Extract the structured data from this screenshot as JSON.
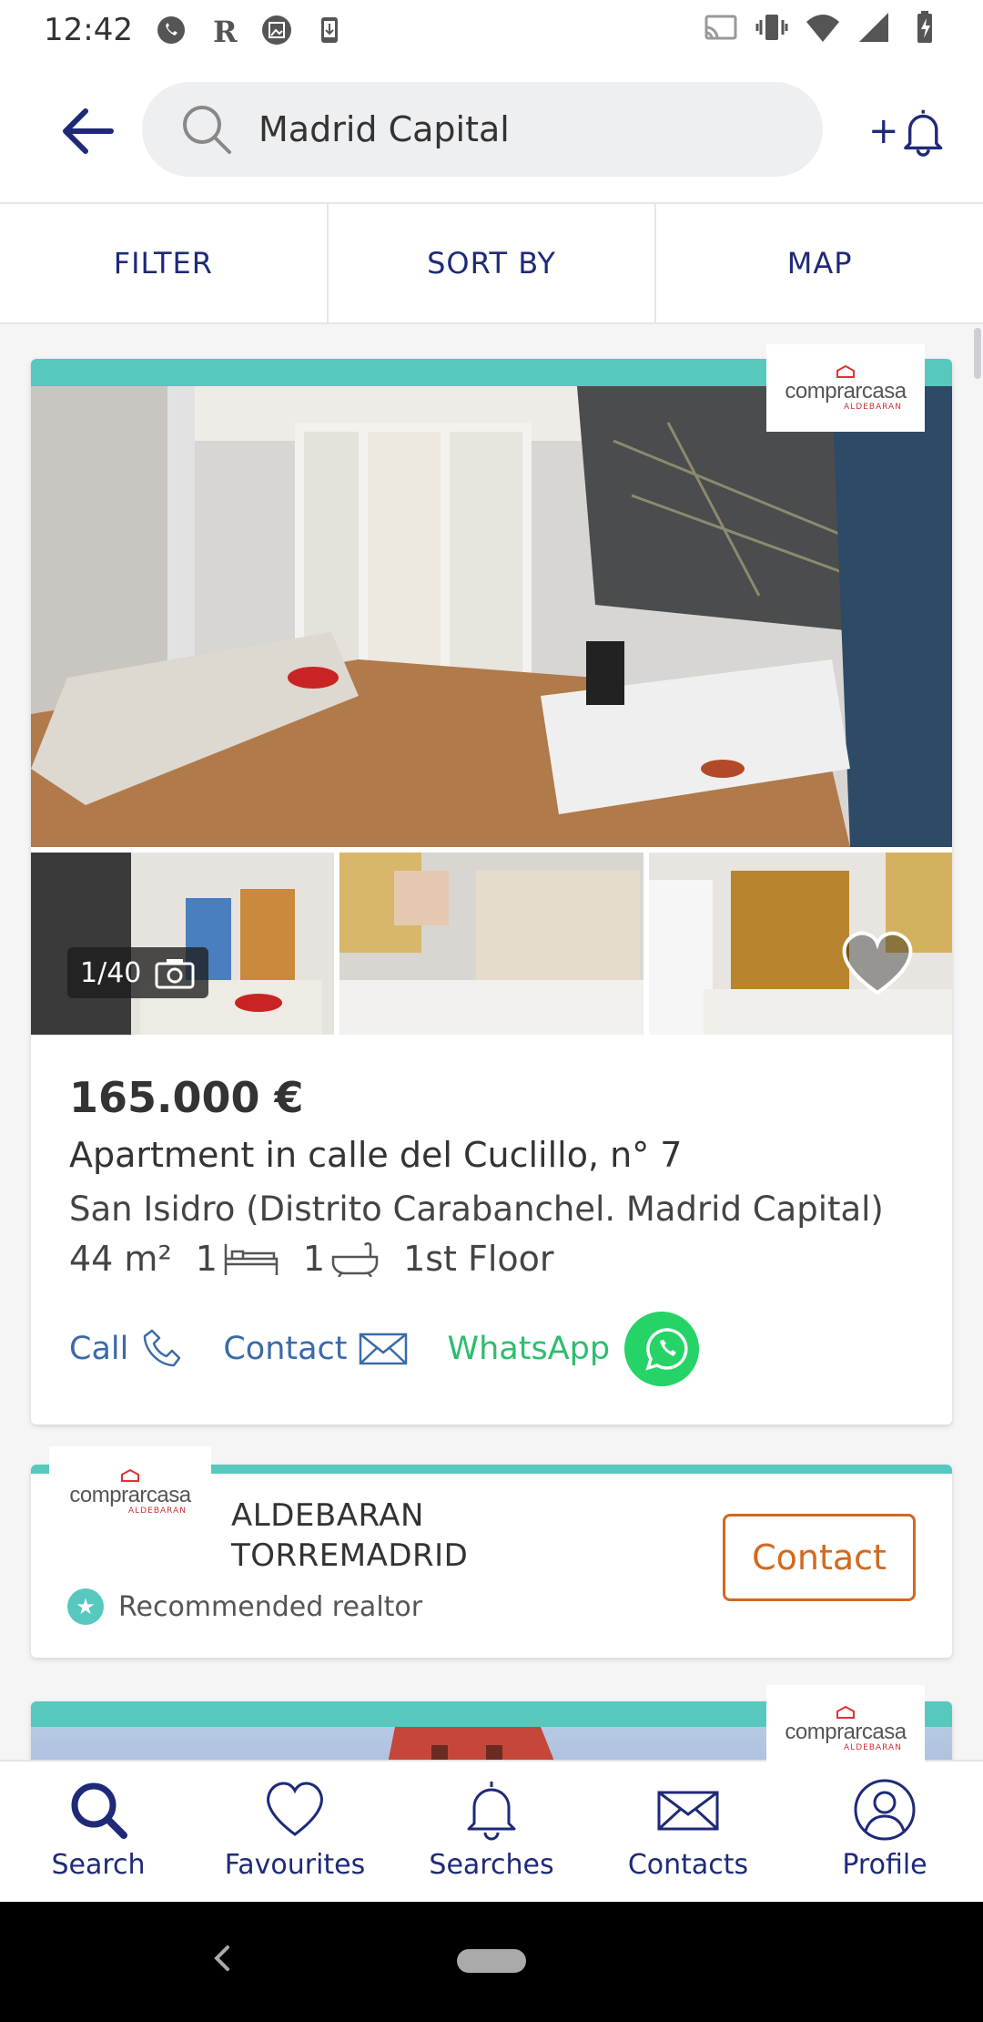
{
  "status_bar": {
    "time": "12:42"
  },
  "header": {
    "search_value": "Madrid Capital",
    "alert_plus": "+"
  },
  "tabs": [
    {
      "label": "FILTER"
    },
    {
      "label": "SORT BY"
    },
    {
      "label": "MAP"
    }
  ],
  "listing": {
    "agency_logo": "comprarcasa",
    "agency_logo_sub": "ALDEBARAN",
    "photo_counter": "1/40",
    "price": "165.000 €",
    "title": "Apartment in calle del Cuclillo, n° 7",
    "location": "San Isidro (Distrito Carabanchel. Madrid Capital)",
    "area": "44 m²",
    "bedrooms": "1",
    "bathrooms": "1",
    "floor": "1st Floor",
    "actions": {
      "call": "Call",
      "contact": "Contact",
      "whatsapp": "WhatsApp"
    }
  },
  "realtor": {
    "logo": "comprarcasa",
    "logo_sub": "ALDEBARAN",
    "name_line1": "ALDEBARAN",
    "name_line2": "TORREMADRID",
    "badge": "Recommended realtor",
    "contact_button": "Contact"
  },
  "next_listing": {
    "logo": "comprarcasa",
    "logo_sub": "ALDEBARAN"
  },
  "bottom_nav": [
    {
      "label": "Search",
      "icon": "search-icon"
    },
    {
      "label": "Favourites",
      "icon": "heart-icon"
    },
    {
      "label": "Searches",
      "icon": "bell-icon"
    },
    {
      "label": "Contacts",
      "icon": "envelope-icon"
    },
    {
      "label": "Profile",
      "icon": "user-icon"
    }
  ],
  "colors": {
    "brand_navy": "#1e2a78",
    "teal": "#56c8be",
    "link_blue": "#3b6aa8",
    "whatsapp_green": "#25d366",
    "contact_orange": "#d2691e"
  }
}
